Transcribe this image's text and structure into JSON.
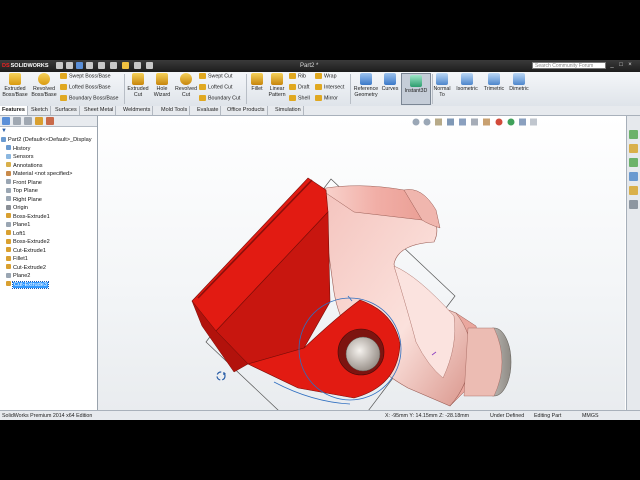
{
  "window": {
    "app_name": "SOLIDWORKS",
    "document_title": "Part2 *",
    "search_placeholder": "Search Community Forum",
    "minimize": "_",
    "restore": "□",
    "close": "×"
  },
  "ribbon": {
    "extruded_boss": "Extruded Boss/Base",
    "revolved_boss": "Revolved Boss/Base",
    "swept_boss": "Swept Boss/Base",
    "lofted_boss": "Lofted Boss/Base",
    "boundary_boss": "Boundary Boss/Base",
    "extruded_cut": "Extruded Cut",
    "hole_wizard": "Hole Wizard",
    "revolved_cut": "Revolved Cut",
    "swept_cut": "Swept Cut",
    "lofted_cut": "Lofted Cut",
    "boundary_cut": "Boundary Cut",
    "fillet": "Fillet",
    "linear_pattern": "Linear Pattern",
    "rib": "Rib",
    "draft": "Draft",
    "shell": "Shell",
    "wrap": "Wrap",
    "intersect": "Intersect",
    "mirror": "Mirror",
    "reference_geometry": "Reference Geometry",
    "curves": "Curves",
    "instant3d": "Instant3D",
    "normal_to": "Normal To",
    "isometric": "Isometric",
    "trimetric": "Trimetric",
    "dimetric": "Dimetric"
  },
  "tabs": [
    "Features",
    "Sketch",
    "Surfaces",
    "Sheet Metal",
    "Weldments",
    "Mold Tools",
    "Evaluate",
    "Office Products",
    "Simulation"
  ],
  "tree": {
    "root": "Part2  (Default<<Default>_Display",
    "items": [
      {
        "label": "History"
      },
      {
        "label": "Sensors"
      },
      {
        "label": "Annotations"
      },
      {
        "label": "Material <not specified>"
      },
      {
        "label": "Front Plane"
      },
      {
        "label": "Top Plane"
      },
      {
        "label": "Right Plane"
      },
      {
        "label": "Origin"
      },
      {
        "label": "Boss-Extrude1"
      },
      {
        "label": "Plane1"
      },
      {
        "label": "Loft1"
      },
      {
        "label": "Boss-Extrude2"
      },
      {
        "label": "Cut-Extrude1"
      },
      {
        "label": "Fillet1"
      },
      {
        "label": "Cut-Extrude2"
      },
      {
        "label": "Plane2"
      },
      {
        "label": "Cut-Extrude3"
      }
    ]
  },
  "status": {
    "edition": "SolidWorks Premium 2014 x64 Edition",
    "coordinates": "X: -95mm Y: 14.15mm Z: -28.18mm",
    "definition": "Under Defined",
    "mode": "Editing Part",
    "units": "MMGS"
  },
  "colors": {
    "model_red": "#e21b12",
    "model_pink": "#f2b8b4",
    "selection_blue": "#3399ff",
    "ribbon_bg": "#e6eaef"
  }
}
